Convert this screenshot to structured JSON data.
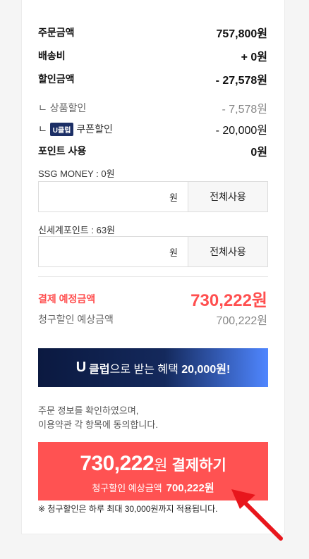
{
  "summary": {
    "order_amount": {
      "label": "주문금액",
      "value": "757,800원"
    },
    "shipping": {
      "label": "배송비",
      "value": "+ 0원"
    },
    "discount": {
      "label": "할인금액",
      "value": "- 27,578원"
    },
    "product_discount": {
      "label": "ㄴ 상품할인",
      "value": "- 7,578원"
    },
    "coupon_discount": {
      "prefix": "ㄴ",
      "badge": "U클럽",
      "label": "쿠폰할인",
      "value": "- 20,000원"
    },
    "point_use": {
      "label": "포인트 사용",
      "value": "0원"
    }
  },
  "ssg_money": {
    "label": "SSG MONEY : 0원",
    "unit": "원",
    "button": "전체사용"
  },
  "shinsegae_point": {
    "label": "신세계포인트 : 63원",
    "unit": "원",
    "button": "전체사용"
  },
  "expected": {
    "label": "결제 예정금액",
    "value": "730,222원",
    "claim_label": "청구할인 예상금액",
    "claim_value": "700,222원"
  },
  "banner": {
    "u": "U",
    "part1": "클럽",
    "part2": "으로 받는 혜택 ",
    "amount": "20,000원!"
  },
  "notice": {
    "line1": "주문 정보를 확인하였으며,",
    "line2": "이용약관 각 항목에 동의합니다."
  },
  "pay_button": {
    "amount": "730,222",
    "won": "원",
    "action": "결제하기",
    "sub_label": "청구할인 예상금액",
    "sub_value": "700,222원"
  },
  "footnote": "※ 청구할인은 하루 최대 30,000원까지 적용됩니다.",
  "colors": {
    "accent_red": "#ff5252",
    "banner_dark": "#0b1940",
    "banner_light": "#4f86ff",
    "badge": "#1c2f66"
  }
}
